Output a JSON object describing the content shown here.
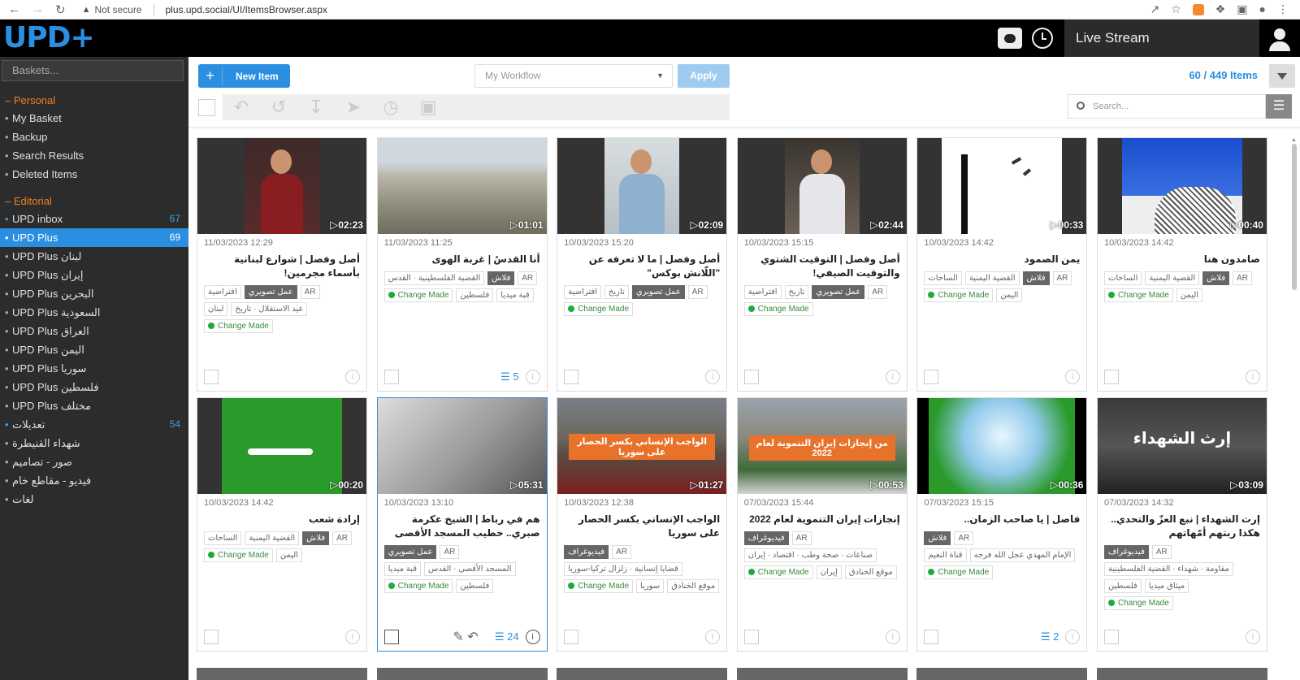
{
  "browser": {
    "security": "Not secure",
    "url": "plus.upd.social/UI/ItemsBrowser.aspx"
  },
  "header": {
    "logo": "UPD+",
    "live_stream": "Live Stream"
  },
  "sidebar": {
    "baskets_placeholder": "Baskets...",
    "sections": [
      {
        "heading": "Personal",
        "items": [
          {
            "label": "My Basket",
            "count": ""
          },
          {
            "label": "Backup",
            "count": ""
          },
          {
            "label": "Search Results",
            "count": ""
          },
          {
            "label": "Deleted Items",
            "count": ""
          }
        ]
      },
      {
        "heading": "Editorial",
        "items": [
          {
            "label": "UPD inbox",
            "count": "67"
          },
          {
            "label": "UPD Plus",
            "count": "69",
            "active": true
          },
          {
            "label": "UPD Plus لبنان",
            "count": ""
          },
          {
            "label": "UPD Plus إيران",
            "count": ""
          },
          {
            "label": "UPD Plus البحرين",
            "count": ""
          },
          {
            "label": "UPD Plus السعودية",
            "count": ""
          },
          {
            "label": "UPD Plus العراق",
            "count": ""
          },
          {
            "label": "UPD Plus اليمن",
            "count": ""
          },
          {
            "label": "UPD Plus سوريا",
            "count": ""
          },
          {
            "label": "UPD Plus فلسطين",
            "count": ""
          },
          {
            "label": "UPD Plus مختلف",
            "count": ""
          },
          {
            "label": "تعديلات",
            "count": "54"
          },
          {
            "label": "شهداء القنيطرة",
            "count": ""
          },
          {
            "label": "صور - تصاميم",
            "count": ""
          },
          {
            "label": "فيديو - مقاطع خام",
            "count": ""
          },
          {
            "label": "لغات",
            "count": ""
          }
        ]
      }
    ]
  },
  "toolbar": {
    "new_item": "New Item",
    "workflow_placeholder": "My Workflow",
    "apply": "Apply",
    "count": "60 / 449 Items",
    "search_placeholder": "Search..."
  },
  "cards": [
    {
      "date": "11/03/2023 12:29",
      "duration": "02:23",
      "title": "أصل وفصل | شوارع لبنانية بأسماء مجرمين!",
      "tags": [
        "AR",
        "عمل تصويري",
        "افتراضية",
        "عيد الاستقلال · تاريخ",
        "لبنان",
        "Change Made"
      ],
      "dark": [
        "عمل تصويري"
      ],
      "layers": "",
      "thumb": "man-red"
    },
    {
      "date": "11/03/2023 11:25",
      "duration": "01:01",
      "title": "أنا القدسُ | غربة الهوى",
      "tags": [
        "AR",
        "فلاش",
        "القضية الفلسطينية · القدس",
        "قبة ميديا",
        "فلسطين",
        "Change Made"
      ],
      "dark": [
        "فلاش"
      ],
      "layers": "5",
      "thumb": "city"
    },
    {
      "date": "10/03/2023 15:20",
      "duration": "02:09",
      "title": "أصل وفصل | ما لا تعرفه عن \"اللّانش بوكس\"",
      "tags": [
        "AR",
        "عمل تصويري",
        "تاريخ",
        "افتراضية",
        "Change Made"
      ],
      "dark": [
        "عمل تصويري"
      ],
      "layers": "",
      "thumb": "man-blue"
    },
    {
      "date": "10/03/2023 15:15",
      "duration": "02:44",
      "title": "أصل وفصل | التوقيت الشتوي والتوقيت الصيفي!",
      "tags": [
        "AR",
        "عمل تصويري",
        "تاريخ",
        "افتراضية",
        "Change Made"
      ],
      "dark": [
        "عمل تصويري"
      ],
      "layers": "",
      "thumb": "man-white"
    },
    {
      "date": "10/03/2023 14:42",
      "duration": "00:33",
      "title": "يمن الصمود",
      "tags": [
        "AR",
        "فلاش",
        "القضية اليمنية",
        "الساحات",
        "اليمن",
        "Change Made"
      ],
      "dark": [
        "فلاش"
      ],
      "layers": "",
      "thumb": "sketch"
    },
    {
      "date": "10/03/2023 14:42",
      "duration": "00:40",
      "title": "صامدون هنا",
      "tags": [
        "AR",
        "فلاش",
        "القضية اليمنية",
        "الساحات",
        "اليمن",
        "Change Made"
      ],
      "dark": [
        "فلاش"
      ],
      "layers": "",
      "thumb": "sky"
    },
    {
      "date": "10/03/2023 14:42",
      "duration": "00:20",
      "title": "إرادة شعب",
      "tags": [
        "AR",
        "فلاش",
        "القضية اليمنية",
        "الساحات",
        "اليمن",
        "Change Made"
      ],
      "dark": [
        "فلاش"
      ],
      "layers": "",
      "thumb": "green"
    },
    {
      "date": "10/03/2023 13:10",
      "duration": "05:31",
      "title": "هم في رباط | الشيخ عكرمة صبري.. خطيب المسجد الأقصى",
      "tags": [
        "AR",
        "عمل تصويري",
        "المسجد الأقصى · القدس",
        "قبة ميديا",
        "فلسطين",
        "Change Made"
      ],
      "dark": [
        "عمل تصويري"
      ],
      "layers": "24",
      "thumb": "gray",
      "selected": true
    },
    {
      "date": "10/03/2023 12:38",
      "duration": "01:27",
      "title": "الواجب الإنساني بكسر الحصار على سوريا",
      "tags": [
        "AR",
        "فيديوغراف",
        "قضايا إنسانية · زلزال تركيا-سوريا",
        "موقع الخنادق",
        "سوريا",
        "Change Made"
      ],
      "dark": [
        "فيديوغراف"
      ],
      "layers": "",
      "thumb": "crowd",
      "banner": "الواجب الإنساني بكسر الحصار على سوريا"
    },
    {
      "date": "07/03/2023 15:44",
      "duration": "00:53",
      "title": "إنجازات إيران التنموية لعام 2022",
      "tags": [
        "AR",
        "فيديوغراف",
        "صناعات · صحة وطب · اقتصاد · إيران",
        "موقع الخنادق",
        "إيران",
        "Change Made"
      ],
      "dark": [
        "فيديوغراف"
      ],
      "layers": "",
      "thumb": "team",
      "banner": "من إنجازات إيران التنموية لعام 2022"
    },
    {
      "date": "07/03/2023 15:15",
      "duration": "00:36",
      "title": "فاصل | يا صاحب الزمان..",
      "tags": [
        "AR",
        "فلاش",
        "الإمام المهدي عجل الله فرجه",
        "قناة النعيم",
        "Change Made"
      ],
      "dark": [
        "فلاش"
      ],
      "layers": "2",
      "thumb": "meadow"
    },
    {
      "date": "07/03/2023 14:32",
      "duration": "03:09",
      "title": "إرث الشهداء | نبع العزّ والتحدي.. هكذا ربتهم أمّهاتهم",
      "tags": [
        "AR",
        "فيديوغراف",
        "مقاومة · شهداء · القضية الفلسطينية",
        "ميثاق ميديا",
        "فلسطين",
        "Change Made"
      ],
      "dark": [
        "فيديوغراف"
      ],
      "layers": "",
      "thumb": "martyr",
      "banner": "إرث الشهداء"
    }
  ]
}
